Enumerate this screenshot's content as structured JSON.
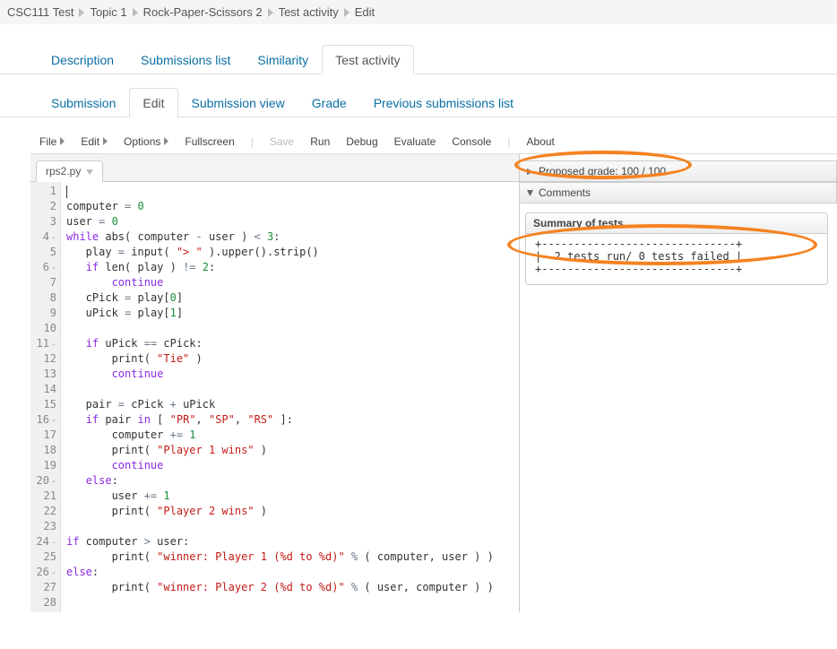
{
  "breadcrumb": [
    "CSC111 Test",
    "Topic 1",
    "Rock-Paper-Scissors 2",
    "Test activity",
    "Edit"
  ],
  "tabsPrimary": [
    {
      "label": "Description",
      "active": false
    },
    {
      "label": "Submissions list",
      "active": false
    },
    {
      "label": "Similarity",
      "active": false
    },
    {
      "label": "Test activity",
      "active": true
    }
  ],
  "tabsSecondary": [
    {
      "label": "Submission",
      "active": false
    },
    {
      "label": "Edit",
      "active": true
    },
    {
      "label": "Submission view",
      "active": false
    },
    {
      "label": "Grade",
      "active": false
    },
    {
      "label": "Previous submissions list",
      "active": false
    }
  ],
  "toolbar": {
    "file": "File",
    "edit": "Edit",
    "options": "Options",
    "fullscreen": "Fullscreen",
    "save": "Save",
    "run": "Run",
    "debug": "Debug",
    "evaluate": "Evaluate",
    "console": "Console",
    "about": "About"
  },
  "fileTab": "rps2.py",
  "code": {
    "lines": [
      {
        "n": 1,
        "fold": false,
        "tokens": [
          [
            "cursor",
            ""
          ]
        ]
      },
      {
        "n": 2,
        "fold": false,
        "tokens": [
          [
            "plain",
            "computer "
          ],
          [
            "op",
            "="
          ],
          [
            "plain",
            " "
          ],
          [
            "num",
            "0"
          ]
        ]
      },
      {
        "n": 3,
        "fold": false,
        "tokens": [
          [
            "plain",
            "user "
          ],
          [
            "op",
            "="
          ],
          [
            "plain",
            " "
          ],
          [
            "num",
            "0"
          ]
        ]
      },
      {
        "n": 4,
        "fold": true,
        "tokens": [
          [
            "kw",
            "while"
          ],
          [
            "plain",
            " abs( computer "
          ],
          [
            "op",
            "-"
          ],
          [
            "plain",
            " user ) "
          ],
          [
            "op",
            "<"
          ],
          [
            "plain",
            " "
          ],
          [
            "num",
            "3"
          ],
          [
            "plain",
            ":"
          ]
        ]
      },
      {
        "n": 5,
        "fold": false,
        "tokens": [
          [
            "plain",
            "   play "
          ],
          [
            "op",
            "="
          ],
          [
            "plain",
            " input( "
          ],
          [
            "str",
            "\"> \""
          ],
          [
            "plain",
            " ).upper().strip()"
          ]
        ]
      },
      {
        "n": 6,
        "fold": true,
        "tokens": [
          [
            "plain",
            "   "
          ],
          [
            "kw",
            "if"
          ],
          [
            "plain",
            " len( play ) "
          ],
          [
            "op",
            "!="
          ],
          [
            "plain",
            " "
          ],
          [
            "num",
            "2"
          ],
          [
            "plain",
            ":"
          ]
        ]
      },
      {
        "n": 7,
        "fold": false,
        "tokens": [
          [
            "plain",
            "       "
          ],
          [
            "kw",
            "continue"
          ]
        ]
      },
      {
        "n": 8,
        "fold": false,
        "tokens": [
          [
            "plain",
            "   cPick "
          ],
          [
            "op",
            "="
          ],
          [
            "plain",
            " play["
          ],
          [
            "num",
            "0"
          ],
          [
            "plain",
            "]"
          ]
        ]
      },
      {
        "n": 9,
        "fold": false,
        "tokens": [
          [
            "plain",
            "   uPick "
          ],
          [
            "op",
            "="
          ],
          [
            "plain",
            " play["
          ],
          [
            "num",
            "1"
          ],
          [
            "plain",
            "]"
          ]
        ]
      },
      {
        "n": 10,
        "fold": false,
        "tokens": []
      },
      {
        "n": 11,
        "fold": true,
        "tokens": [
          [
            "plain",
            "   "
          ],
          [
            "kw",
            "if"
          ],
          [
            "plain",
            " uPick "
          ],
          [
            "op",
            "=="
          ],
          [
            "plain",
            " cPick:"
          ]
        ]
      },
      {
        "n": 12,
        "fold": false,
        "tokens": [
          [
            "plain",
            "       print( "
          ],
          [
            "str",
            "\"Tie\""
          ],
          [
            "plain",
            " )"
          ]
        ]
      },
      {
        "n": 13,
        "fold": false,
        "tokens": [
          [
            "plain",
            "       "
          ],
          [
            "kw",
            "continue"
          ]
        ]
      },
      {
        "n": 14,
        "fold": false,
        "tokens": []
      },
      {
        "n": 15,
        "fold": false,
        "tokens": [
          [
            "plain",
            "   pair "
          ],
          [
            "op",
            "="
          ],
          [
            "plain",
            " cPick "
          ],
          [
            "op",
            "+"
          ],
          [
            "plain",
            " uPick"
          ]
        ]
      },
      {
        "n": 16,
        "fold": true,
        "tokens": [
          [
            "plain",
            "   "
          ],
          [
            "kw",
            "if"
          ],
          [
            "plain",
            " pair "
          ],
          [
            "kw",
            "in"
          ],
          [
            "plain",
            " [ "
          ],
          [
            "str",
            "\"PR\""
          ],
          [
            "plain",
            ", "
          ],
          [
            "str",
            "\"SP\""
          ],
          [
            "plain",
            ", "
          ],
          [
            "str",
            "\"RS\""
          ],
          [
            "plain",
            " ]:"
          ]
        ]
      },
      {
        "n": 17,
        "fold": false,
        "tokens": [
          [
            "plain",
            "       computer "
          ],
          [
            "op",
            "+="
          ],
          [
            "plain",
            " "
          ],
          [
            "num",
            "1"
          ]
        ]
      },
      {
        "n": 18,
        "fold": false,
        "tokens": [
          [
            "plain",
            "       print( "
          ],
          [
            "str",
            "\"Player 1 wins\""
          ],
          [
            "plain",
            " )"
          ]
        ]
      },
      {
        "n": 19,
        "fold": false,
        "tokens": [
          [
            "plain",
            "       "
          ],
          [
            "kw",
            "continue"
          ]
        ]
      },
      {
        "n": 20,
        "fold": true,
        "tokens": [
          [
            "plain",
            "   "
          ],
          [
            "kw",
            "else"
          ],
          [
            "plain",
            ":"
          ]
        ]
      },
      {
        "n": 21,
        "fold": false,
        "tokens": [
          [
            "plain",
            "       user "
          ],
          [
            "op",
            "+="
          ],
          [
            "plain",
            " "
          ],
          [
            "num",
            "1"
          ]
        ]
      },
      {
        "n": 22,
        "fold": false,
        "tokens": [
          [
            "plain",
            "       print( "
          ],
          [
            "str",
            "\"Player 2 wins\""
          ],
          [
            "plain",
            " )"
          ]
        ]
      },
      {
        "n": 23,
        "fold": false,
        "tokens": []
      },
      {
        "n": 24,
        "fold": true,
        "tokens": [
          [
            "kw",
            "if"
          ],
          [
            "plain",
            " computer "
          ],
          [
            "op",
            ">"
          ],
          [
            "plain",
            " user:"
          ]
        ]
      },
      {
        "n": 25,
        "fold": false,
        "tokens": [
          [
            "plain",
            "       print( "
          ],
          [
            "str",
            "\"winner: Player 1 (%d to %d)\""
          ],
          [
            "plain",
            " "
          ],
          [
            "op",
            "%"
          ],
          [
            "plain",
            " ( computer, user ) )"
          ]
        ]
      },
      {
        "n": 26,
        "fold": true,
        "tokens": [
          [
            "kw",
            "else"
          ],
          [
            "plain",
            ":"
          ]
        ]
      },
      {
        "n": 27,
        "fold": false,
        "tokens": [
          [
            "plain",
            "       print( "
          ],
          [
            "str",
            "\"winner: Player 2 (%d to %d)\""
          ],
          [
            "plain",
            " "
          ],
          [
            "op",
            "%"
          ],
          [
            "plain",
            " ( user, computer ) )"
          ]
        ]
      },
      {
        "n": 28,
        "fold": false,
        "tokens": []
      }
    ]
  },
  "rightPanel": {
    "proposedGrade": "Proposed grade: 100 / 100",
    "comments": "Comments",
    "summaryTitle": "Summary of tests",
    "summaryBody": "+------------------------------+\n|  2 tests run/ 0 tests failed |\n+------------------------------+"
  }
}
